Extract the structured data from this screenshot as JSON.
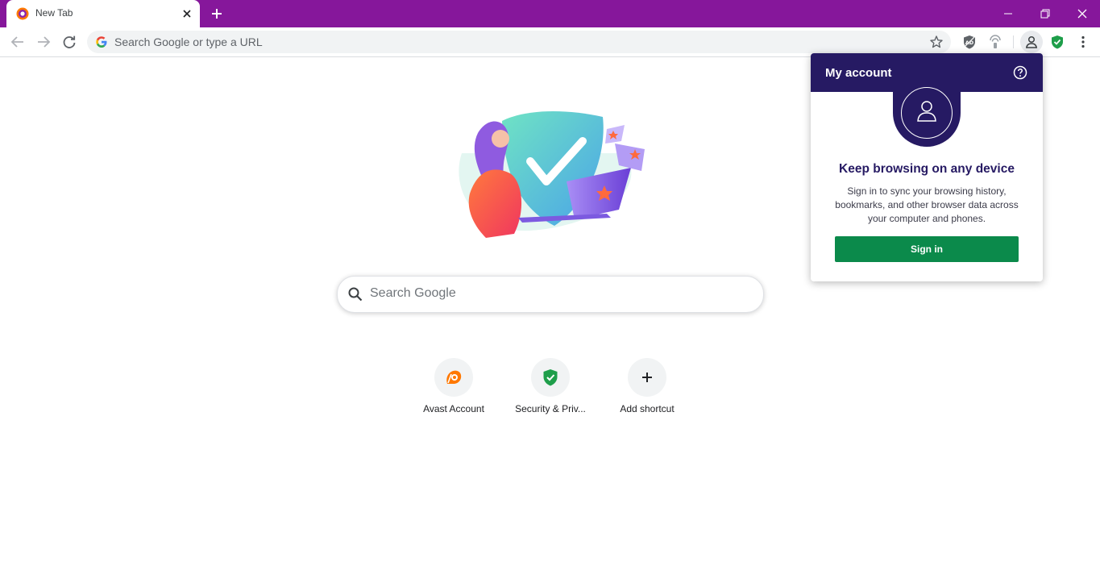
{
  "browser": {
    "tab": {
      "title": "New Tab"
    },
    "omnibox": {
      "placeholder": "Search Google or type a URL"
    }
  },
  "colors": {
    "titlebar": "#86179b",
    "popup_header": "#261a63",
    "signin_button": "#0b8a4b",
    "shield_green": "#1e9e4a",
    "avast_orange": "#ff7800"
  },
  "newtab": {
    "search": {
      "placeholder": "Search Google"
    },
    "shortcuts": [
      {
        "label": "Avast Account",
        "icon": "avast-logo-icon"
      },
      {
        "label": "Security & Priv...",
        "icon": "green-shield-check-icon"
      },
      {
        "label": "Add shortcut",
        "icon": "plus-icon"
      }
    ]
  },
  "popup": {
    "title": "My account",
    "heading": "Keep browsing on any device",
    "body": "Sign in to sync your browsing history, bookmarks, and other browser data across your computer and phones.",
    "signin_label": "Sign in"
  }
}
